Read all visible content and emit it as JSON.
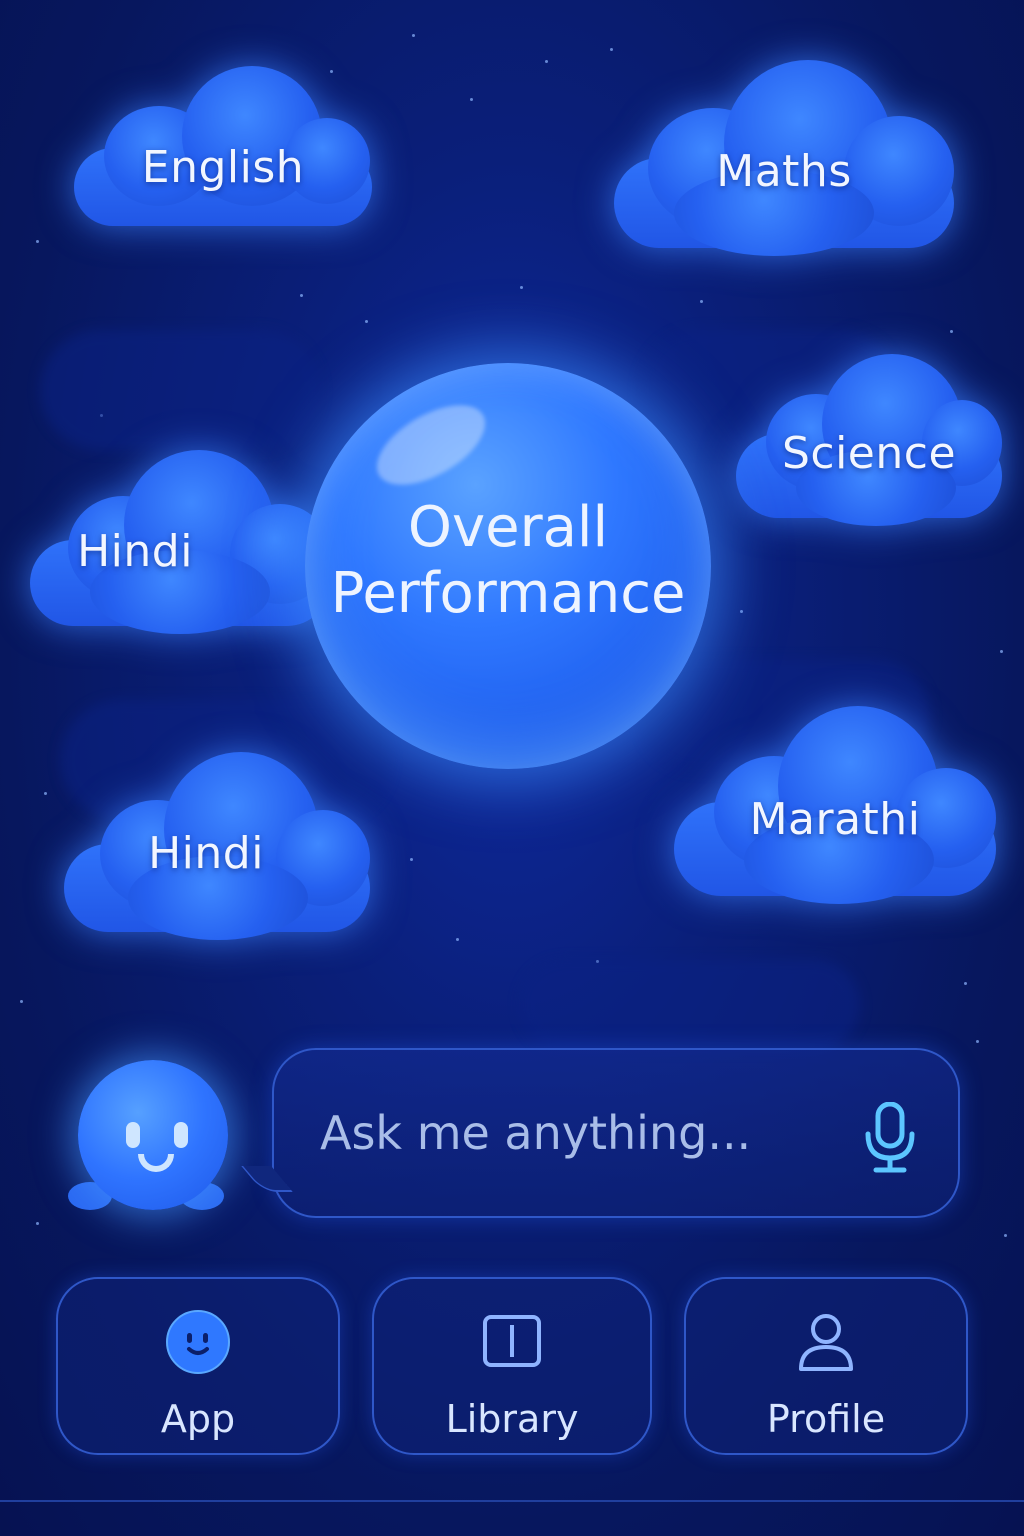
{
  "subjects": {
    "english": "English",
    "maths": "Maths",
    "science": "Science",
    "hindi_1": "Hindi",
    "hindi_2": "Hindi",
    "marathi": "Marathi"
  },
  "center": {
    "line1": "Overall",
    "line2": "Performance"
  },
  "chat": {
    "placeholder": "Ask me anything...",
    "mic_icon": "microphone-icon"
  },
  "nav": {
    "items": [
      {
        "label": "App",
        "icon": "assistant-face-icon"
      },
      {
        "label": "Library",
        "icon": "book-icon"
      },
      {
        "label": "Profile",
        "icon": "user-icon"
      }
    ]
  },
  "colors": {
    "background": "#0a1f7a",
    "accent": "#2f74ff",
    "glow": "#3c8cff"
  }
}
